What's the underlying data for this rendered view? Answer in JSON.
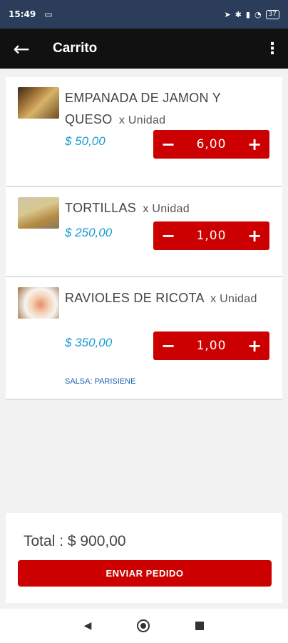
{
  "status_bar": {
    "time": "15:49",
    "battery": "37",
    "icons": [
      "laptop-icon",
      "location-icon",
      "bluetooth-icon",
      "signal-icon",
      "wifi-icon",
      "battery-icon"
    ]
  },
  "app_bar": {
    "title": "Carrito",
    "back_icon": "arrow-left-icon",
    "more_icon": "more-vert-icon"
  },
  "cart_items": [
    {
      "name": "EMPANADA DE JAMON Y QUESO",
      "unit": "x Unidad",
      "price": "$ 50,00",
      "quantity": "6,00"
    },
    {
      "name": "TORTILLAS",
      "unit": "x Unidad",
      "price": "$ 250,00",
      "quantity": "1,00"
    },
    {
      "name": "RAVIOLES DE RICOTA",
      "unit": "x Unidad",
      "price": "$ 350,00",
      "quantity": "1,00",
      "note": "SALSA: PARISIENE"
    }
  ],
  "stepper": {
    "minus": "−",
    "plus": "+"
  },
  "footer": {
    "total": "Total : $ 900,00",
    "submit_label": "ENVIAR PEDIDO"
  },
  "colors": {
    "status_bar": "#2b3d5b",
    "app_bar": "#111111",
    "accent_red": "#cc0000",
    "price_blue": "#1a9bd4",
    "note_blue": "#1f5fb2"
  }
}
